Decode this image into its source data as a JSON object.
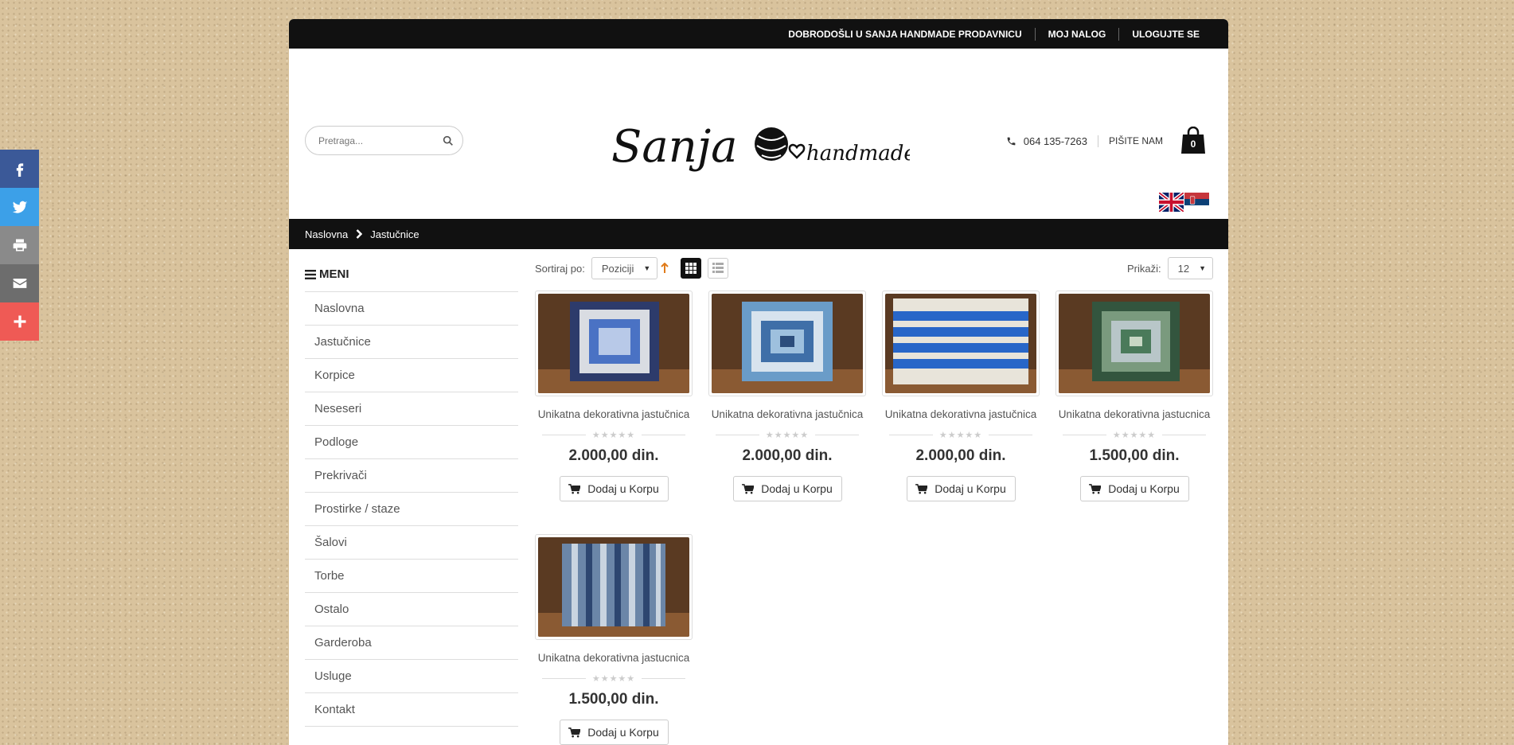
{
  "topbar": {
    "welcome": "DOBRODOŠLI U SANJA HANDMADE PRODAVNICU",
    "account": "MOJ NALOG",
    "login": "ULOGUJTE SE"
  },
  "header": {
    "search_placeholder": "Pretraga...",
    "logo_main": "Sanja",
    "logo_sub": "handmade",
    "phone": "064 135-7263",
    "write_us": "PIŠITE NAM",
    "cart_count": "0"
  },
  "breadcrumb": {
    "home": "Naslovna",
    "current": "Jastučnice"
  },
  "menu": {
    "title": "MENI",
    "items": [
      "Naslovna",
      "Jastučnice",
      "Korpice",
      "Neseseri",
      "Podloge",
      "Prekrivači",
      "Prostirke / staze",
      "Šalovi",
      "Torbe",
      "Ostalo",
      "Garderoba",
      "Usluge",
      "Kontakt"
    ]
  },
  "toolbar": {
    "sort_label": "Sortiraj po:",
    "sort_value": "Poziciji",
    "show_label": "Prikaži:",
    "show_value": "12"
  },
  "products": [
    {
      "name": "Unikatna dekorativna jastučnica",
      "price": "2.000,00 din.",
      "button": "Dodaj u Korpu"
    },
    {
      "name": "Unikatna dekorativna jastučnica",
      "price": "2.000,00 din.",
      "button": "Dodaj u Korpu"
    },
    {
      "name": "Unikatna dekorativna jastučnica",
      "price": "2.000,00 din.",
      "button": "Dodaj u Korpu"
    },
    {
      "name": "Unikatna dekorativna jastucnica",
      "price": "1.500,00 din.",
      "button": "Dodaj u Korpu"
    },
    {
      "name": "Unikatna dekorativna jastucnica",
      "price": "1.500,00 din.",
      "button": "Dodaj u Korpu"
    }
  ],
  "colors": {
    "facebook": "#3b5998",
    "twitter": "#3ca0e8",
    "print": "#8a8a8a",
    "email": "#6d6d6d",
    "share": "#ef5a55",
    "bar": "#111111"
  }
}
